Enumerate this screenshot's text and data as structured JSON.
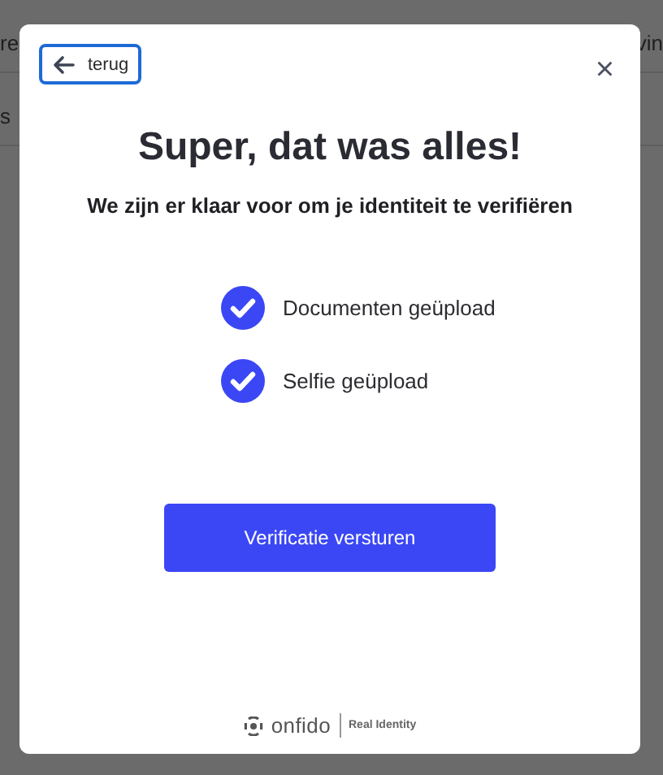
{
  "background_page": {
    "lines": [
      {
        "left": "re",
        "right": "vin"
      },
      {
        "left": "s"
      }
    ]
  },
  "modal": {
    "back_button": {
      "label": "terug",
      "focused": true
    },
    "close_label": "×",
    "title": "Super, dat was alles!",
    "subtitle": "We zijn er klaar voor om je identiteit te verifiëren",
    "checklist": [
      {
        "label": "Documenten geüpload",
        "checked": true
      },
      {
        "label": "Selfie geüpload",
        "checked": true
      }
    ],
    "submit_button": "Verificatie versturen",
    "footer": {
      "brand": "onfido",
      "tagline": "Real Identity"
    }
  }
}
